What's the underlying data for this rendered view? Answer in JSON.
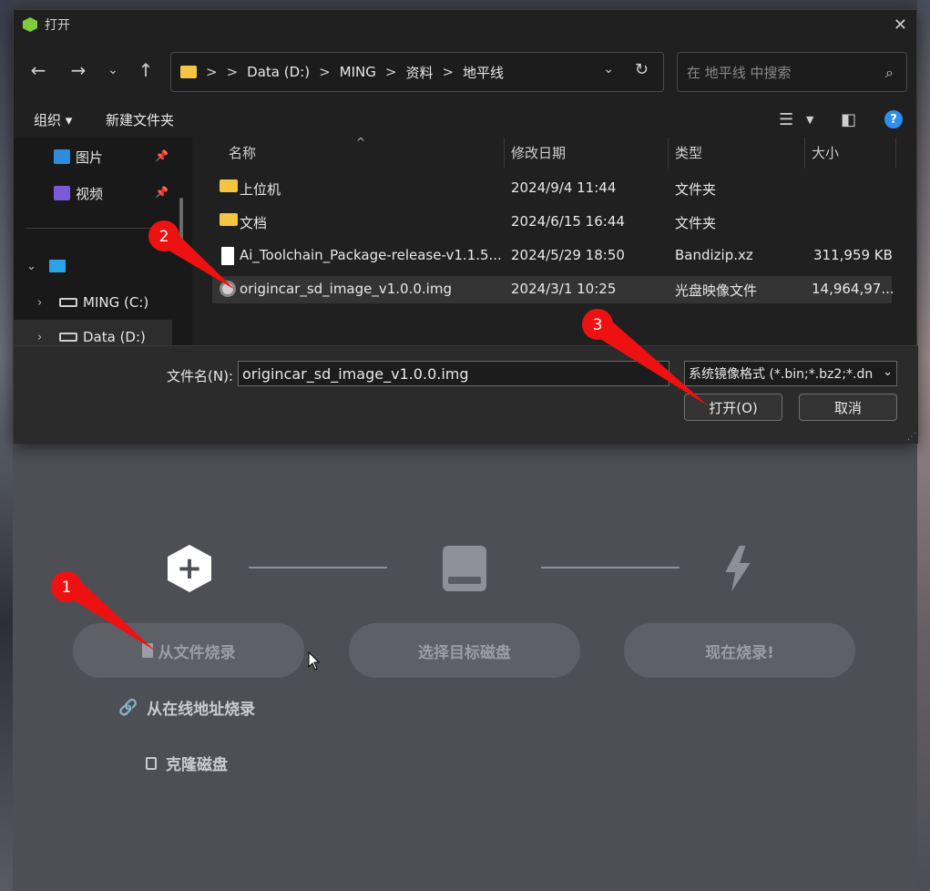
{
  "dialog": {
    "title": "打开",
    "breadcrumb": [
      "Data (D:)",
      "MING",
      "资料",
      "地平线"
    ],
    "breadcrumb_sep": ">",
    "search_placeholder": "在 地平线 中搜索",
    "organize_label": "组织 ▾",
    "new_folder_label": "新建文件夹",
    "sidebar": [
      {
        "label": "图片",
        "icon": "pictures-icon"
      },
      {
        "label": "视频",
        "icon": "videos-icon"
      },
      {
        "label": "MING (C:)",
        "icon": "drive-icon"
      },
      {
        "label": "Data (D:)",
        "icon": "drive-icon"
      }
    ],
    "columns": {
      "name": "名称",
      "date": "修改日期",
      "type": "类型",
      "size": "大小"
    },
    "files": [
      {
        "name": "上位机",
        "date": "2024/9/4 11:44",
        "type": "文件夹",
        "size": "",
        "icon": "folder-icon"
      },
      {
        "name": "文档",
        "date": "2024/6/15 16:44",
        "type": "文件夹",
        "size": "",
        "icon": "folder-icon"
      },
      {
        "name": "Ai_Toolchain_Package-release-v1.1.5...",
        "date": "2024/5/29 18:50",
        "type": "Bandizip.xz",
        "size": "311,959 KB",
        "icon": "archive-icon"
      },
      {
        "name": "origincar_sd_image_v1.0.0.img",
        "date": "2024/3/1 10:25",
        "type": "光盘映像文件",
        "size": "14,964,97...",
        "icon": "disc-image-icon"
      }
    ],
    "filename_label": "文件名(N):",
    "filename_value": "origincar_sd_image_v1.0.0.img",
    "filter_value": "系统镜像格式 (*.bin;*.bz2;*.dn",
    "open_label": "打开(O)",
    "cancel_label": "取消"
  },
  "app": {
    "step1_label": "从文件烧录",
    "step2_label": "选择目标磁盘",
    "step3_label": "现在烧录!",
    "url_flash_label": "从在线地址烧录",
    "clone_label": "克隆磁盘"
  },
  "annotations": [
    "1",
    "2",
    "3"
  ],
  "colors": {
    "annotation": "#ee1111",
    "dialog_bg": "#202020",
    "app_bg": "#4d4f55",
    "accent": "#2c8ef0"
  }
}
